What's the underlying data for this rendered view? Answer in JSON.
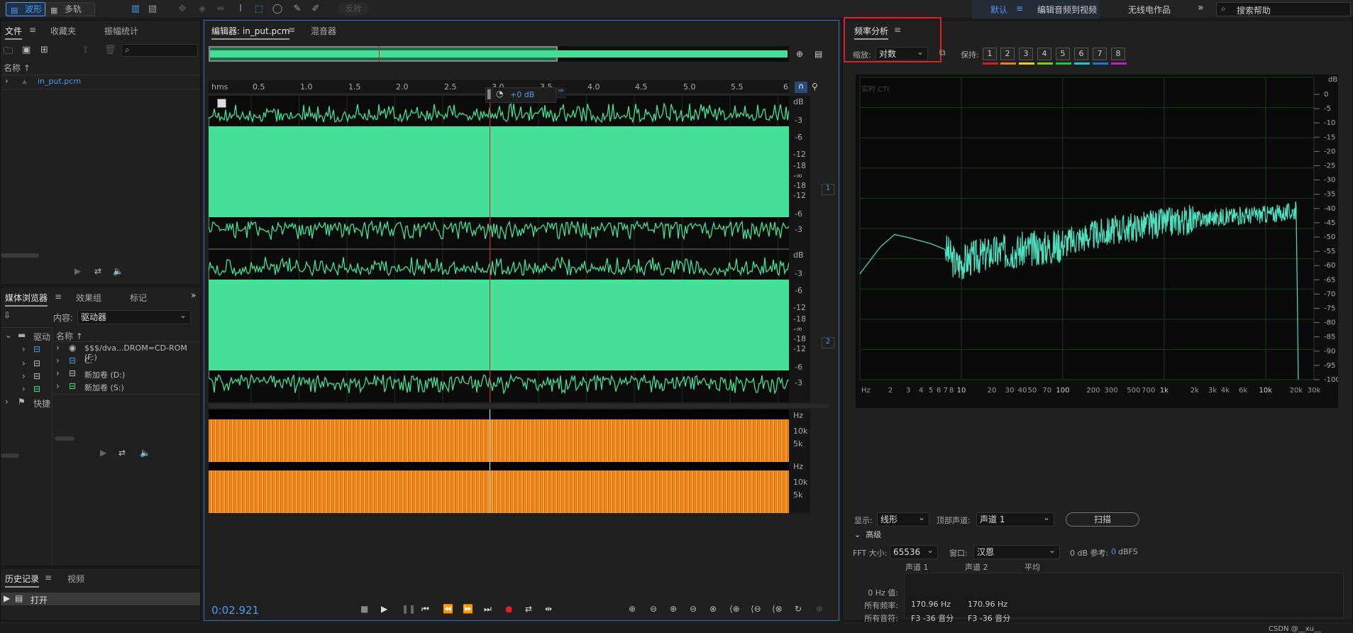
{
  "top": {
    "waveform": "波形",
    "multitrack": "多轨",
    "disabled": "反转",
    "workspace": "默认",
    "menu_icon": "≡",
    "edit_av": "编辑音频到视频",
    "radio": "无线电作品",
    "more": "»",
    "search_placeholder": "搜索帮助"
  },
  "files": {
    "tab_files": "文件",
    "tab_fav": "收藏夹",
    "tab_amp": "振幅统计",
    "col_name": "名称",
    "item": "in_put.pcm"
  },
  "media": {
    "tab_browser": "媒体浏览器",
    "tab_fx": "效果组",
    "tab_marker": "标记",
    "content_label": "内容:",
    "content_value": "驱动器",
    "col_name": "名称",
    "left_items": [
      "驱动",
      "快捷"
    ],
    "drives": [
      "$$$/dva...DROM=CD-ROM (F:)",
      "C:",
      "新加卷 (D:)",
      "新加卷 (S:)"
    ]
  },
  "history": {
    "tab_history": "历史记录",
    "tab_video": "视频",
    "item": "打开"
  },
  "editor": {
    "tab_editor": "编辑器: in_put.pcm",
    "tab_mixer": "混音器",
    "time_unit": "hms",
    "time_ticks": [
      "0.5",
      "1.0",
      "1.5",
      "2.0",
      "2.5",
      "3.0",
      "3.5",
      "4.0",
      "4.5",
      "5.0",
      "5.5",
      "6"
    ],
    "hud_db": "+0 dB",
    "db_unit": "dB",
    "db_labels": [
      "-3",
      "-6",
      "-12",
      "-18",
      "-∞",
      "-18",
      "-12",
      "-6",
      "-3"
    ],
    "channels": [
      "1",
      "2"
    ],
    "hz_unit": "Hz",
    "spec_labels": [
      "10k",
      "5k"
    ],
    "current_time": "0:02.921"
  },
  "freq": {
    "title": "频率分析",
    "scale_label": "缩放:",
    "scale_value": "对数",
    "hold_label": "保持:",
    "holds": [
      "1",
      "2",
      "3",
      "4",
      "5",
      "6",
      "7",
      "8"
    ],
    "hold_colors": [
      "#d81e1e",
      "#e8801a",
      "#e6d21a",
      "#74d21a",
      "#1ac84a",
      "#1ac8d8",
      "#1a7ad8",
      "#c81ad8"
    ],
    "overlay": "实时 CTI",
    "db_axis_unit": "dB",
    "db_axis": [
      "0",
      "-5",
      "-10",
      "-15",
      "-20",
      "-25",
      "-30",
      "-35",
      "-40",
      "-45",
      "-50",
      "-55",
      "-60",
      "-65",
      "-70",
      "-75",
      "-80",
      "-85",
      "-90",
      "-95",
      "-100"
    ],
    "hz_axis": [
      "Hz",
      "2",
      "3",
      "4",
      "5",
      "6",
      "7",
      "8",
      "10",
      "20",
      "30",
      "40",
      "50",
      "70",
      "100",
      "200",
      "300",
      "500",
      "700",
      "1k",
      "2k",
      "3k",
      "4k",
      "6k",
      "10k",
      "20k",
      "30k"
    ],
    "display_label": "显示:",
    "display_value": "线形",
    "top_channel_label": "顶部声道:",
    "top_channel_value": "声道 1",
    "scan": "扫描",
    "advanced": "高级",
    "fft_label": "FFT 大小:",
    "fft_value": "65536",
    "window_label": "窗口:",
    "window_value": "汉恩",
    "ref_label": "0 dB 参考:",
    "ref_value": "0",
    "ref_unit": "dBFS",
    "tbl_headers": [
      "声道 1",
      "声道 2",
      "平均"
    ],
    "row_labels": [
      "0 Hz 值:",
      "所有频率:",
      "所有音符:"
    ],
    "row_values": [
      [
        "",
        ""
      ],
      [
        "170.96 Hz",
        "170.96 Hz"
      ],
      [
        "F3 -36 音分",
        "F3 -36 音分"
      ]
    ],
    "watermark": "CSDN @__xu__"
  },
  "colors": {
    "waveform": "#45df98",
    "accent": "#4b9cf2",
    "playhead": "#d02020",
    "spectrum": "#4fe0c0",
    "highlight": "#e02020"
  }
}
